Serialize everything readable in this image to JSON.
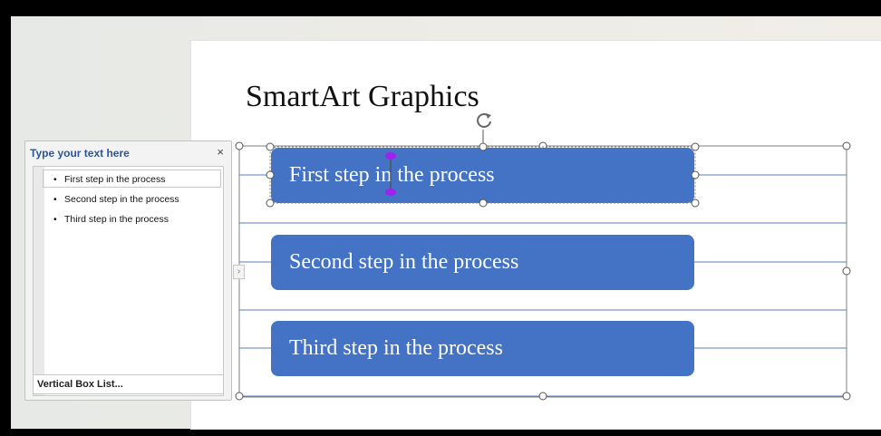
{
  "slide": {
    "title": "SmartArt Graphics"
  },
  "smartart": {
    "steps": [
      "First step in the process",
      "Second step in the process",
      "Third step in the process"
    ],
    "box_color": "#4472c4",
    "selection_color": "#808080",
    "text_cursor_color": "#a020f0"
  },
  "text_pane": {
    "title": "Type your text here",
    "close_glyph": "×",
    "items": [
      "First step in the process",
      "Second step in the process",
      "Third step in the process"
    ],
    "layout_name": "Vertical Box List...",
    "expander_glyph": "›"
  }
}
